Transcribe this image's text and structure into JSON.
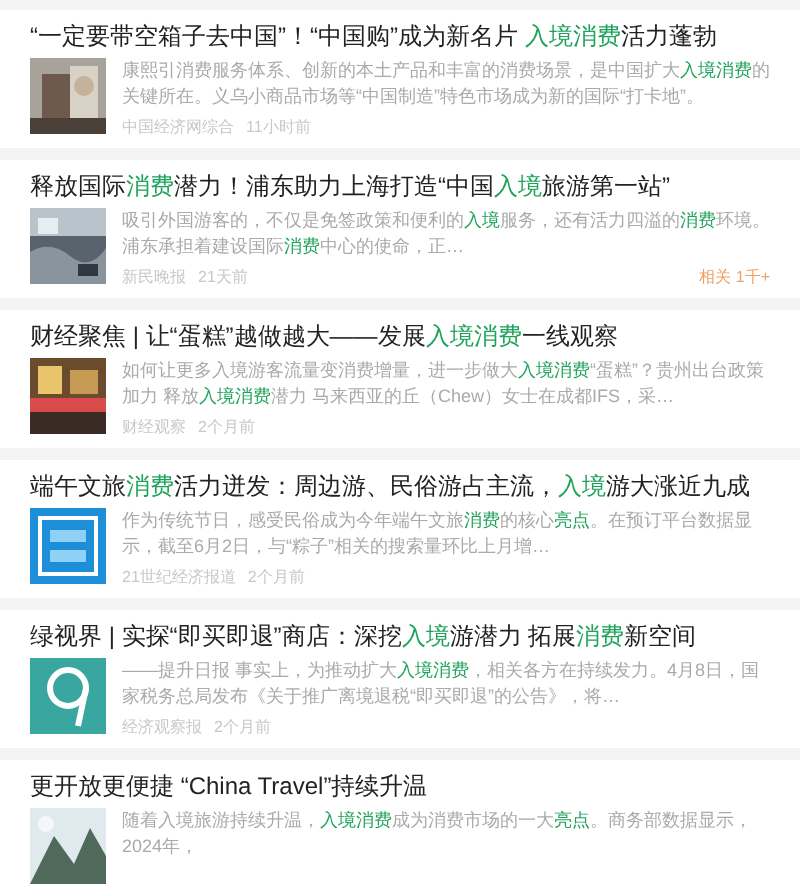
{
  "articles": [
    {
      "title": [
        {
          "text": "“一定要带空箱子去中国”！“中国购”成为新名片 ",
          "highlight": false
        },
        {
          "text": "入境消费",
          "highlight": true
        },
        {
          "text": "活力蓬勃",
          "highlight": false
        }
      ],
      "thumbnail": {
        "kind": "picture"
      },
      "summary": [
        {
          "text": "康熙引消费服务体系、创新的本土产品和丰富的消费场景，是中国扩大",
          "highlight": false
        },
        {
          "text": "入境消费",
          "highlight": true
        },
        {
          "text": "的关键所在。义乌小商品市场等“中国制造”特色市场成为新的国际“打卡地”。",
          "highlight": false
        }
      ],
      "source": "中国经济网综合",
      "time": "11小时前"
    },
    {
      "title": [
        {
          "text": "释放国际",
          "highlight": false
        },
        {
          "text": "消费",
          "highlight": true
        },
        {
          "text": "潜力！浦东助力上海打造“中国",
          "highlight": false
        },
        {
          "text": "入境",
          "highlight": true
        },
        {
          "text": "旅游第一站”",
          "highlight": false
        }
      ],
      "thumbnail": {
        "kind": "picture"
      },
      "summary": [
        {
          "text": "吸引外国游客的，不仅是免签政策和便利的",
          "highlight": false
        },
        {
          "text": "入境",
          "highlight": true
        },
        {
          "text": "服务，还有活力四溢的",
          "highlight": false
        },
        {
          "text": "消费",
          "highlight": true
        },
        {
          "text": "环境。浦东承担着建设国际",
          "highlight": false
        },
        {
          "text": "消费",
          "highlight": true
        },
        {
          "text": "中心的使命，正…",
          "highlight": false
        }
      ],
      "source": "新民晚报",
      "time": "21天前",
      "related": "相关 1千+"
    },
    {
      "title": [
        {
          "text": "财经聚焦 | 让“蛋糕”越做越大——发展",
          "highlight": false
        },
        {
          "text": "入境消费",
          "highlight": true
        },
        {
          "text": "一线观察",
          "highlight": false
        }
      ],
      "thumbnail": {
        "kind": "picture"
      },
      "summary": [
        {
          "text": "如何让更多入境游客流量变消费增量，进一步做大",
          "highlight": false
        },
        {
          "text": "入境消费",
          "highlight": true
        },
        {
          "text": "“蛋糕”？贵州出台政策加力 释放",
          "highlight": false
        },
        {
          "text": "入境消费",
          "highlight": true
        },
        {
          "text": "潜力 马来西亚的丘（Chew）女士在成都IFS，采…",
          "highlight": false
        }
      ],
      "source": "财经观察",
      "time": "2个月前"
    },
    {
      "title": [
        {
          "text": "端午文旅",
          "highlight": false
        },
        {
          "text": "消费",
          "highlight": true
        },
        {
          "text": "活力迸发：周边游、民俗游占主流，",
          "highlight": false
        },
        {
          "text": "入境",
          "highlight": true
        },
        {
          "text": "游大涨近九成",
          "highlight": false
        }
      ],
      "thumbnail": {
        "kind": "picture"
      },
      "summary": [
        {
          "text": "作为传统节日，感受民俗成为今年端午文旅",
          "highlight": false
        },
        {
          "text": "消费",
          "highlight": true
        },
        {
          "text": "的核心",
          "highlight": false
        },
        {
          "text": "亮点",
          "highlight": true
        },
        {
          "text": "。在预订平台数据显示，截至6月2日，与“粽子”相关的搜索量环比上月增…",
          "highlight": false
        }
      ],
      "source": "21世纪经济报道",
      "time": "2个月前"
    },
    {
      "title": [
        {
          "text": "绿视界 | 实探“即买即退”商店：深挖",
          "highlight": false
        },
        {
          "text": "入境",
          "highlight": true
        },
        {
          "text": "游潜力 拓展",
          "highlight": false
        },
        {
          "text": "消费",
          "highlight": true
        },
        {
          "text": "新空间",
          "highlight": false
        }
      ],
      "thumbnail": {
        "kind": "picture"
      },
      "summary": [
        {
          "text": "——提升日报 事实上，为推动扩大",
          "highlight": false
        },
        {
          "text": "入境消费",
          "highlight": true
        },
        {
          "text": "，相关各方在持续发力。4月8日，国家税务总局发布《关于推广离境退税“即买即退”的公告》，将…",
          "highlight": false
        }
      ],
      "source": "经济观察报",
      "time": "2个月前"
    },
    {
      "title": [
        {
          "text": "更开放更便捷 “China Travel”持续升温",
          "highlight": false
        }
      ],
      "thumbnail": {
        "kind": "picture"
      },
      "summary": [
        {
          "text": "随着入境旅游持续升温，",
          "highlight": false
        },
        {
          "text": "入境消费",
          "highlight": true
        },
        {
          "text": "成为消费市场的一大",
          "highlight": false
        },
        {
          "text": "亮点",
          "highlight": true
        },
        {
          "text": "。商务部数据显示，2024年，",
          "highlight": false
        }
      ]
    }
  ]
}
